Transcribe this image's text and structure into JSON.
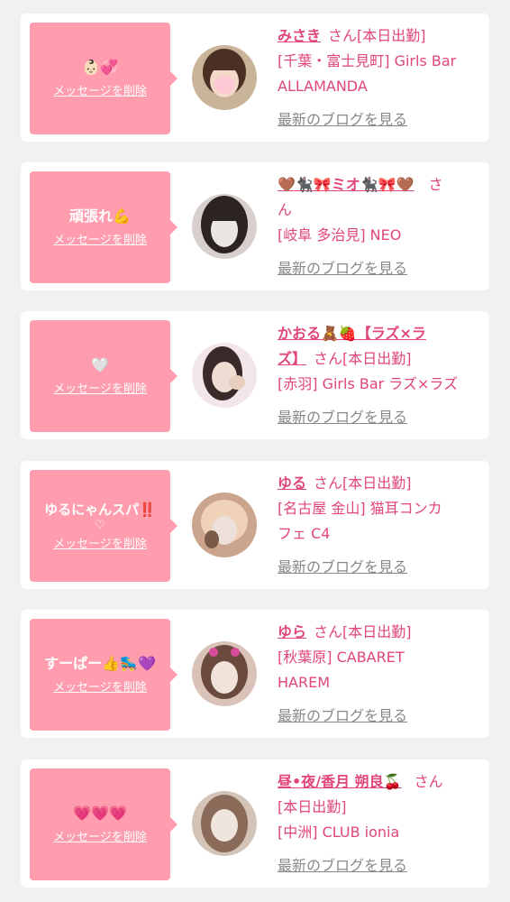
{
  "cards": [
    {
      "message": "👶🏻💞",
      "delete_label": "メッセージを削除",
      "name": "みさき",
      "san": "さん",
      "shop_line1": "[本日出勤]",
      "shop_line2": "[千葉・富士見町] Girls Bar",
      "shop_line3": "ALLAMANDA",
      "blog_label": "最新のブログを見る",
      "avatar_colors": [
        "#c9b49a",
        "#f4d9c8",
        "#5a3b2c"
      ]
    },
    {
      "message": "頑張れ💪",
      "delete_label": "メッセージを削除",
      "name": "🤎🐈‍⬛🎀ミオ🐈‍⬛🎀🤎",
      "san": "さ",
      "san2": "ん",
      "shop_line1": "[岐阜 多治見] NEO",
      "blog_label": "最新のブログを見る",
      "avatar_colors": [
        "#d8d0cc",
        "#2b2420",
        "#ece6e2"
      ]
    },
    {
      "message": "🤍",
      "delete_label": "メッセージを削除",
      "name": "かおる🧸🍓【ラズ×ラ",
      "name2": "ズ】",
      "san": "さん[本日出勤]",
      "shop_line1": "[赤羽] Girls Bar ラズ×ラズ",
      "blog_label": "最新のブログを見る",
      "avatar_colors": [
        "#f3e6ea",
        "#3a2a2a",
        "#e8cfc0"
      ]
    },
    {
      "message": "ゆるにゃんスパ‼️",
      "message_extra": "♡",
      "delete_label": "メッセージを削除",
      "name": "ゆる",
      "san": "さん[本日出勤]",
      "shop_line1": "[名古屋 金山] 猫耳コンカ",
      "shop_line2": "フェ C4",
      "blog_label": "最新のブログを見る",
      "avatar_colors": [
        "#caa48c",
        "#ece0d8",
        "#7a5a48"
      ]
    },
    {
      "message": "すーぱー👍🛼💜",
      "delete_label": "メッセージを削除",
      "name": "ゆら",
      "san": "さん[本日出勤]",
      "shop_line1": "[秋葉原] CABARET",
      "shop_line2": "HAREM",
      "blog_label": "最新のブログを見る",
      "avatar_colors": [
        "#d9c3b8",
        "#f1e3da",
        "#6a4a3c"
      ]
    },
    {
      "message": "💗💗💗",
      "delete_label": "メッセージを削除",
      "name": "昼•夜/香月 朔良🍒",
      "san": "さん",
      "shop_line1": "[本日出勤]",
      "shop_line2": "[中洲] CLUB ionia",
      "blog_label": "最新のブログを見る",
      "avatar_colors": [
        "#d4c4b8",
        "#8a6a58",
        "#efe5dd"
      ]
    }
  ]
}
